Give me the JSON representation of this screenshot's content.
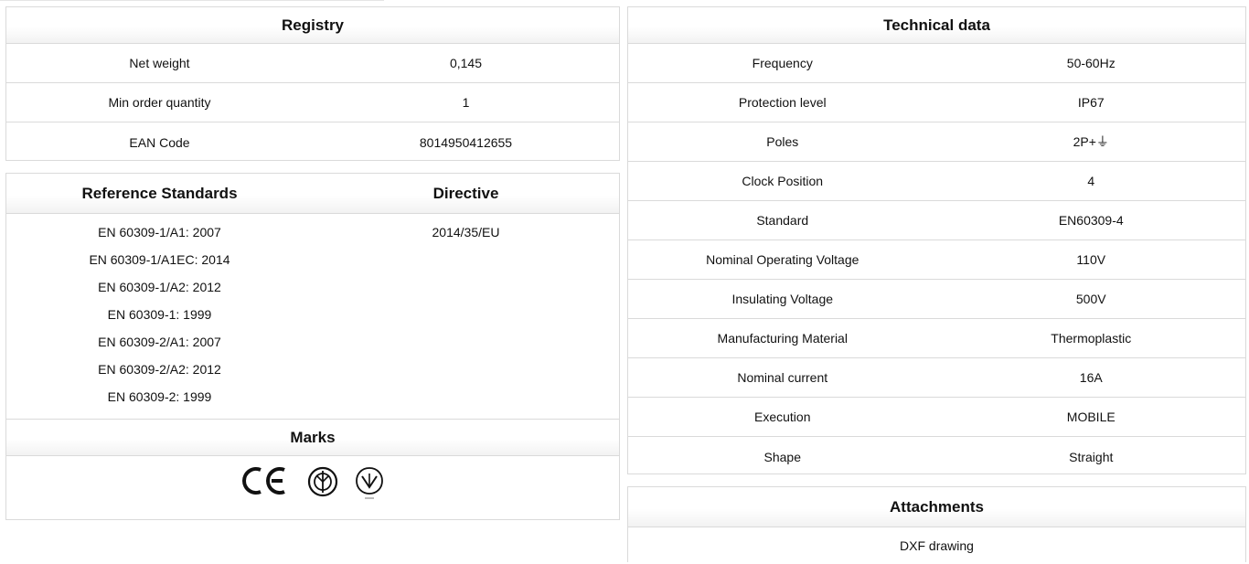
{
  "registry": {
    "title": "Registry",
    "rows": [
      {
        "label": "Net weight",
        "value": "0,145"
      },
      {
        "label": "Min order quantity",
        "value": "1"
      },
      {
        "label": "EAN Code",
        "value": "8014950412655"
      }
    ]
  },
  "standards": {
    "title": "Reference Standards",
    "directive_title": "Directive",
    "items": [
      "EN 60309-1/A1: 2007",
      "EN 60309-1/A1EC: 2014",
      "EN 60309-1/A2: 2012",
      "EN 60309-1: 1999",
      "EN 60309-2/A1: 2007",
      "EN 60309-2/A2: 2012",
      "EN 60309-2: 1999"
    ],
    "directive": "2014/35/EU"
  },
  "marks": {
    "title": "Marks",
    "icons": [
      "ce-mark-icon",
      "imq-mark-icon",
      "ukrsepro-mark-icon"
    ]
  },
  "technical": {
    "title": "Technical data",
    "rows": [
      {
        "label": "Frequency",
        "value": "50-60Hz"
      },
      {
        "label": "Protection level",
        "value": "IP67"
      },
      {
        "label": "Poles",
        "value": "2P+⏚"
      },
      {
        "label": "Clock Position",
        "value": "4"
      },
      {
        "label": "Standard",
        "value": "EN60309-4"
      },
      {
        "label": "Nominal Operating Voltage",
        "value": "110V"
      },
      {
        "label": "Insulating Voltage",
        "value": "500V"
      },
      {
        "label": "Manufacturing Material",
        "value": "Thermoplastic"
      },
      {
        "label": "Nominal current",
        "value": "16A"
      },
      {
        "label": "Execution",
        "value": "MOBILE"
      },
      {
        "label": "Shape",
        "value": "Straight"
      }
    ]
  },
  "attachments": {
    "title": "Attachments",
    "items": [
      "DXF drawing"
    ]
  }
}
